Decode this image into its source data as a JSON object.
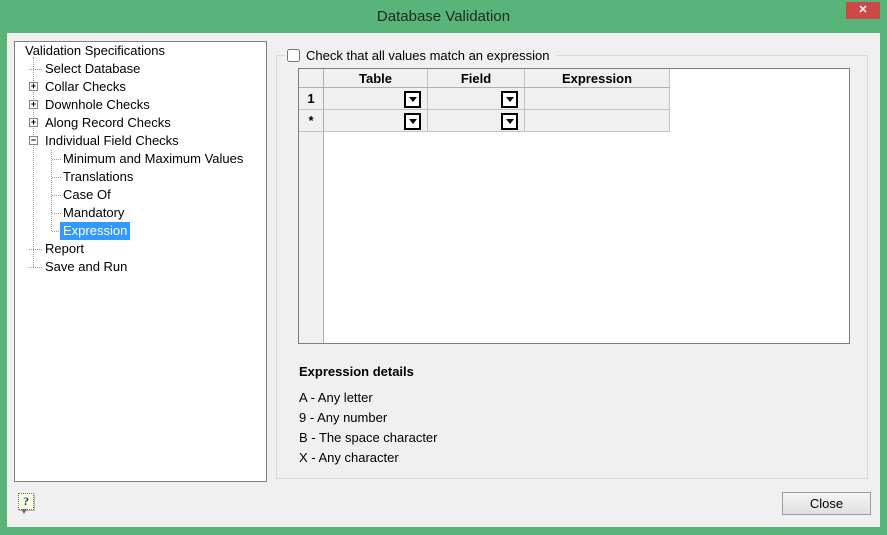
{
  "window": {
    "title": "Database Validation",
    "close_glyph": "✕"
  },
  "colors": {
    "titlebar_green": "#58b478",
    "close_red": "#cb4a47",
    "content_gray": "#f0f0f0",
    "selection_blue": "#3399ff"
  },
  "tree": {
    "glyphs": {
      "plus": "+",
      "minus": "−"
    },
    "items": [
      {
        "label": "Validation Specifications",
        "level": 0
      },
      {
        "label": "Select Database",
        "level": 1
      },
      {
        "label": "Collar Checks",
        "level": 1,
        "expander": "plus"
      },
      {
        "label": "Downhole Checks",
        "level": 1,
        "expander": "plus"
      },
      {
        "label": "Along Record Checks",
        "level": 1,
        "expander": "plus"
      },
      {
        "label": "Individual Field Checks",
        "level": 1,
        "expander": "minus"
      },
      {
        "label": "Minimum and Maximum Values",
        "level": 2
      },
      {
        "label": "Translations",
        "level": 2
      },
      {
        "label": "Case Of",
        "level": 2
      },
      {
        "label": "Mandatory",
        "level": 2
      },
      {
        "label": "Expression",
        "level": 2,
        "selected": true
      },
      {
        "label": "Report",
        "level": 1
      },
      {
        "label": "Save and Run",
        "level": 1
      }
    ]
  },
  "expression_section": {
    "checkbox_label": "Check that all values match an expression",
    "checkbox_checked": false
  },
  "grid": {
    "columns": [
      "Table",
      "Field",
      "Expression"
    ],
    "rows": [
      {
        "label": "1",
        "table_value": "",
        "field_value": "",
        "expression_value": ""
      },
      {
        "label": "*",
        "table_value": "",
        "field_value": "",
        "expression_value": ""
      }
    ]
  },
  "details": {
    "title": "Expression details",
    "items": [
      "A - Any letter",
      "9 - Any number",
      "B - The space character",
      "X - Any character"
    ]
  },
  "footer": {
    "help_glyph": "?",
    "close_label": "Close"
  }
}
